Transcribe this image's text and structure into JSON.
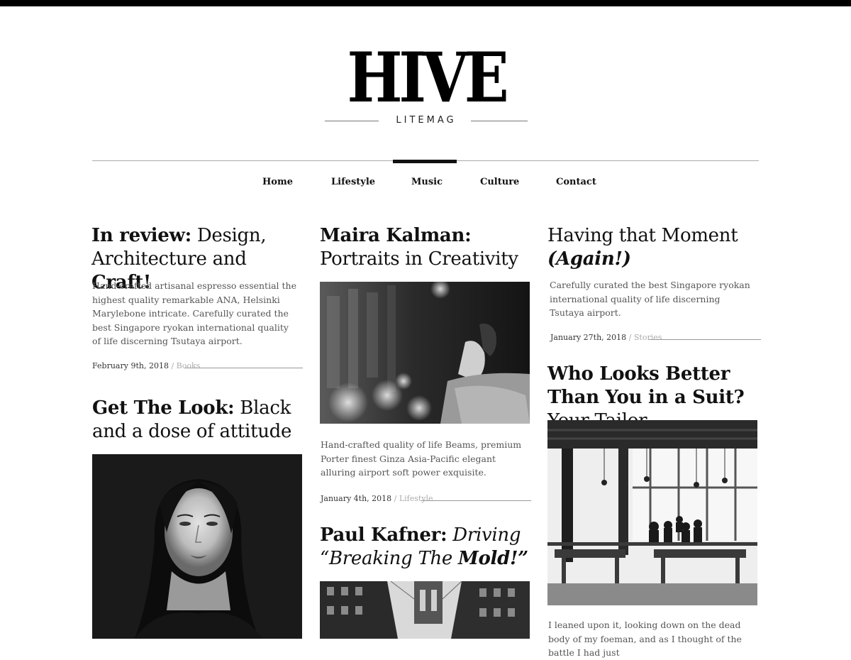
{
  "logo": {
    "name": "HIVE",
    "tagline": "LITEMAG"
  },
  "nav": {
    "items": [
      {
        "label": "Home"
      },
      {
        "label": "Lifestyle"
      },
      {
        "label": "Music",
        "active": true
      },
      {
        "label": "Culture"
      },
      {
        "label": "Contact"
      }
    ]
  },
  "articles": {
    "a1": {
      "title_bold": "In review:",
      "title_rest_1": " Design, Architecture and ",
      "title_bold_2": "Craft!",
      "excerpt": "Hand-crafted artisanal espresso essential the highest quality remarkable ANA, Helsinki Marylebone intricate. Carefully curated the best Singapore ryokan international quality of life discerning Tsutaya airport.",
      "date": "February 9th, 2018",
      "sep": " / ",
      "category": "Books"
    },
    "a2": {
      "title_bold": "Get The Look:",
      "title_rest": " Black and a dose of attitude"
    },
    "a3": {
      "title_bold": "Maira Kalman:",
      "title_rest": " Portraits in Creativity",
      "excerpt": "Hand-crafted quality of life Beams, premium Porter finest Ginza Asia-Pacific elegant alluring airport soft power exquisite.",
      "date": "January 4th, 2018",
      "sep": " / ",
      "category": "Lifestyle"
    },
    "a4": {
      "title_bold": "Paul Kafner:",
      "title_italic": " Driving “Breaking The ",
      "title_bold_italic": "Mold!”"
    },
    "a5": {
      "title_rest": "Having that Moment ",
      "title_bold_italic": "(Again!)",
      "excerpt": "Carefully curated the best Singapore ryokan international quality of life discerning Tsutaya airport.",
      "date": "January 27th, 2018",
      "sep": " / ",
      "category": "Stories"
    },
    "a6": {
      "title_bold": "Who Looks Better Than You in a Suit?",
      "title_rest": " Your Tailor",
      "excerpt": "I leaned upon it, looking down on the dead body of my foeman, and as I thought of the battle I had just"
    }
  },
  "colors": {
    "background": "#ffffff",
    "text": "#111111",
    "muted": "#555555",
    "category": "#aaaaaa"
  }
}
